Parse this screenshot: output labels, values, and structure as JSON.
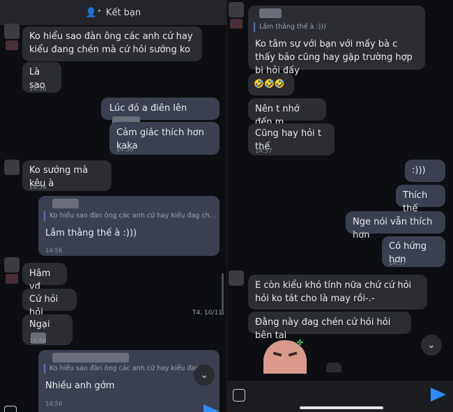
{
  "left": {
    "header": {
      "label": "Kết bạn",
      "icon": "add-friend-icon"
    },
    "messages": [
      {
        "id": "l1",
        "text": "Ko hiểu sao đàn ông các anh cứ hay kiểu đang chén mà cứ hỏi sướng ko"
      },
      {
        "id": "l2",
        "text": "Là sao",
        "time": "14:56"
      },
      {
        "id": "l3",
        "text": "Lúc đó a điên lên"
      },
      {
        "id": "l4",
        "text": "Cảm giác thích hơn kaka",
        "time": "14:56"
      },
      {
        "id": "l5",
        "text": "Ko sướng mà kêu à",
        "time": "14:56"
      },
      {
        "id": "l6",
        "quote": "Ko hiểu sao đàn ông các anh cứ hay kiểu đag ch...",
        "text": "Lắm thằng thế à :)))",
        "time": "14:56"
      },
      {
        "id": "l7",
        "text": "Hâm vđ"
      },
      {
        "id": "l8",
        "text": "Cứ hỏi hỏi"
      },
      {
        "id": "l9",
        "text": "Ngại",
        "time": "14:56"
      },
      {
        "id": "l10",
        "quote": "Ko hiểu sao đàn ông các anh cứ hay kiểu đag ch...",
        "text": "Nhiều anh gớm",
        "time": "14:56"
      }
    ],
    "date_divider": "T4, 10/11"
  },
  "right": {
    "messages": [
      {
        "id": "r1",
        "quote": "Lắm thằng thế à :)))",
        "text": "Ko tâm sự với bạn với mấy bà c thấy bảo cũng hay gặp trường hợp bị hỏi đấy"
      },
      {
        "id": "r2",
        "text": "🤣🤣🤣"
      },
      {
        "id": "r3",
        "text": "Nên t nhớ đến m"
      },
      {
        "id": "r4",
        "text": "Cũng hay hỏi t thế",
        "time": "14:57"
      },
      {
        "id": "r5",
        "text": ":)))"
      },
      {
        "id": "r6",
        "text": "Thích thế"
      },
      {
        "id": "r7",
        "text": "Nge nói vẫn thích hơn"
      },
      {
        "id": "r8",
        "text": "Có hứng hơn",
        "time": "14:57"
      },
      {
        "id": "r9",
        "text": "E còn kiểu khó tính nữa chứ cứ hỏi hỏi ko tát cho là may rồi-.-"
      },
      {
        "id": "r10",
        "text": "Đằng này đag chén cứ hỏi hỏi bên tai"
      }
    ]
  },
  "icons": {
    "emoji": "emoji-icon",
    "send": "send-icon",
    "scroll": "chevron-down-icon"
  },
  "colors": {
    "accent": "#2d8cff",
    "incoming": "#2b2d33",
    "outgoing": "#3a4050"
  }
}
